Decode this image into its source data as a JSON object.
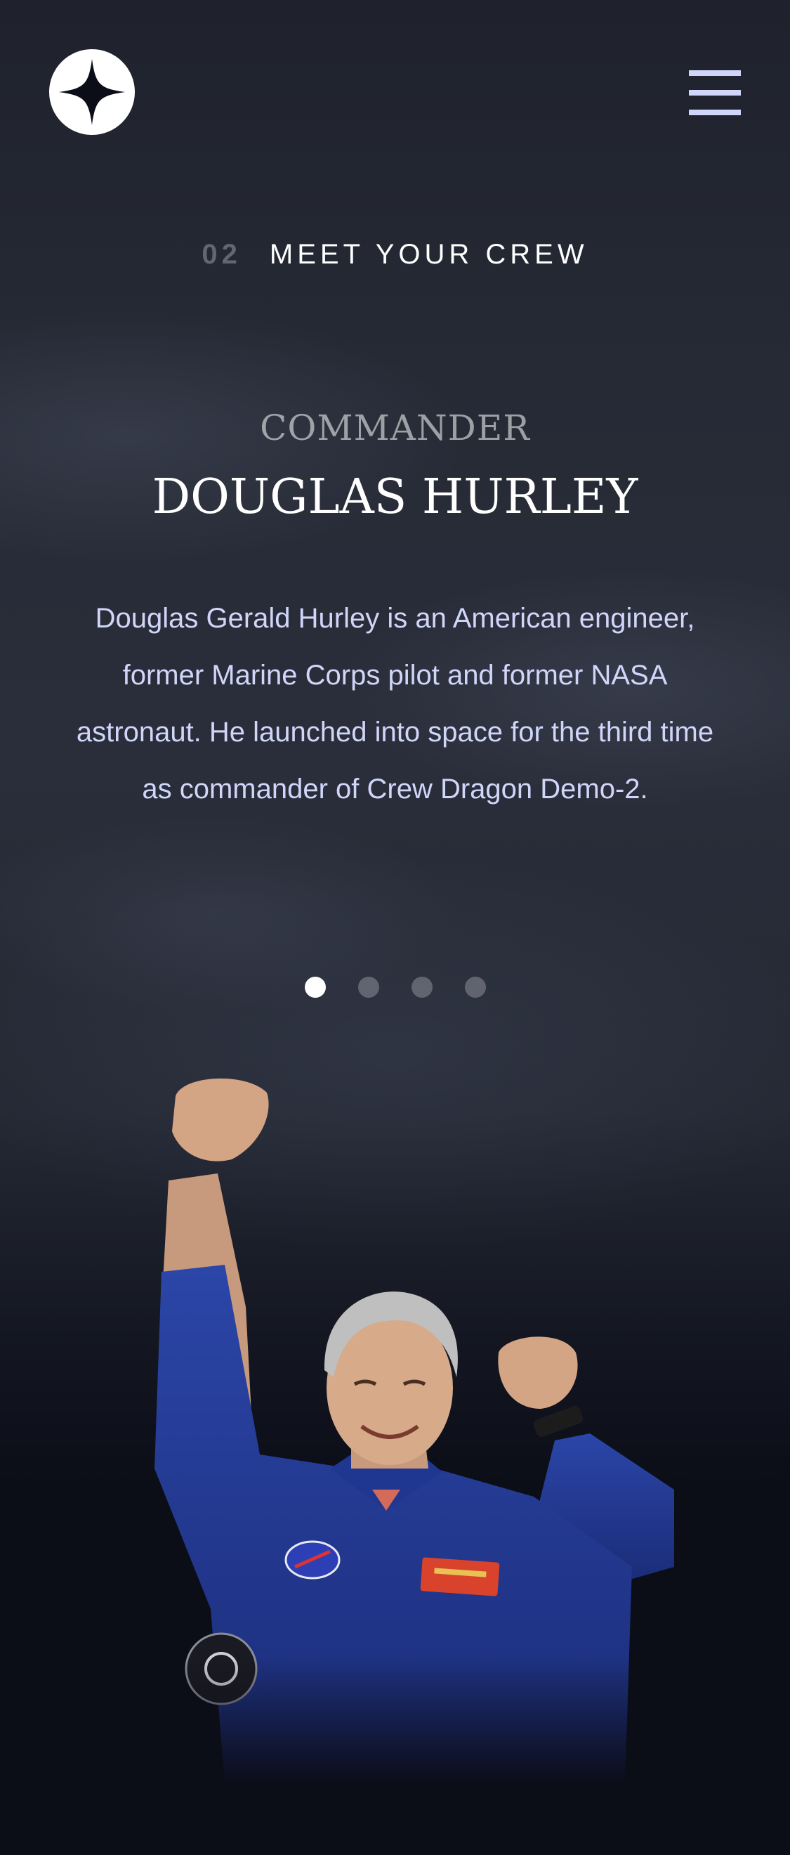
{
  "header": {
    "logo_icon": "star-logo-icon",
    "menu_icon": "hamburger-menu-icon"
  },
  "title": {
    "number": "02",
    "text": "MEET YOUR CREW"
  },
  "crew": {
    "role": "COMMANDER",
    "name": "DOUGLAS HURLEY",
    "bio": "Douglas Gerald Hurley is an American engineer, former Marine Corps pilot and former NASA astronaut. He launched into space for the third time as commander of Crew Dragon Demo-2."
  },
  "pagination": {
    "count": 4,
    "active_index": 0
  },
  "colors": {
    "background": "#0b0d17",
    "accent": "#d0d6f9",
    "muted": "#63666f"
  }
}
